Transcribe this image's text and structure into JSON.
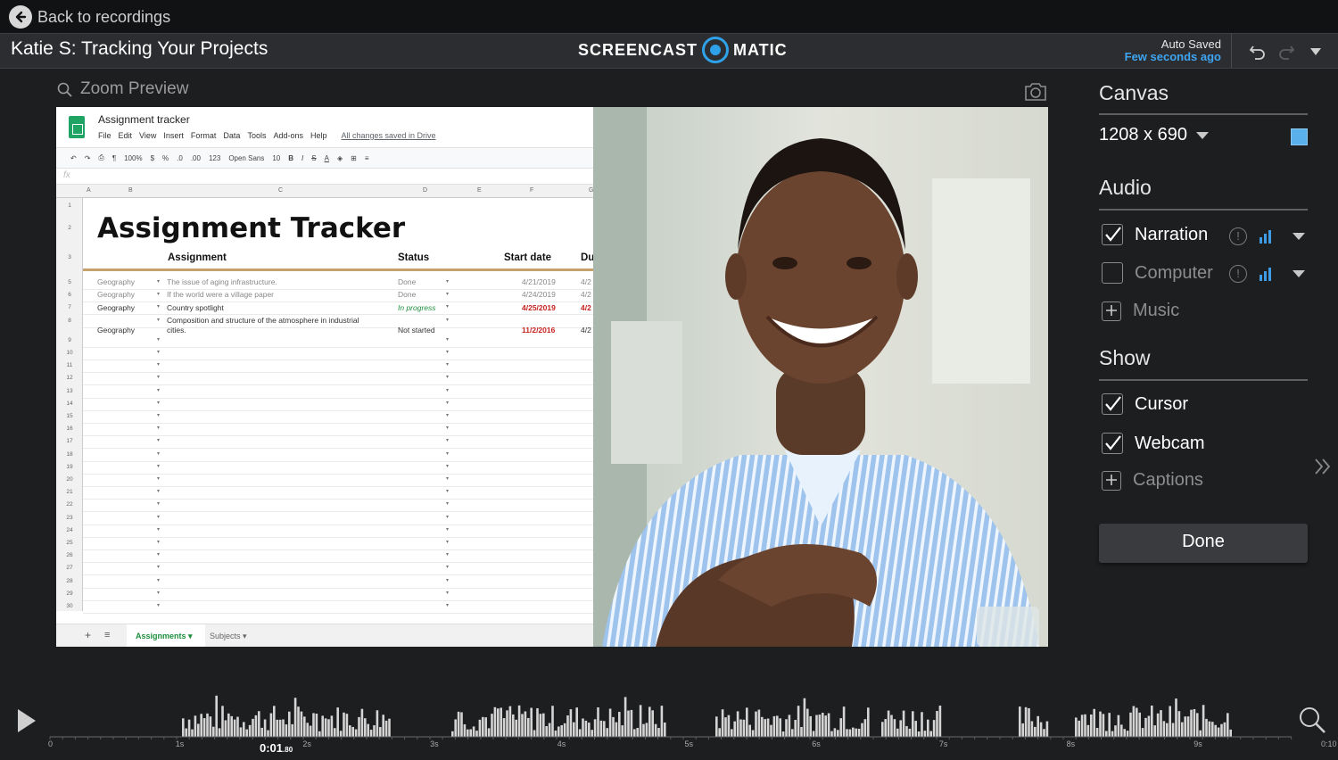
{
  "topbar": {
    "back_label": "Back to recordings"
  },
  "titlebar": {
    "recording_title": "Katie S: Tracking Your Projects",
    "brand_left": "SCREENCAST",
    "brand_right": "MATIC",
    "autosave_label": "Auto Saved",
    "autosave_time": "Few seconds ago"
  },
  "preview": {
    "zoom_label": "Zoom Preview",
    "sheet": {
      "doc_title": "Assignment tracker",
      "menu": [
        "File",
        "Edit",
        "View",
        "Insert",
        "Format",
        "Data",
        "Tools",
        "Add-ons",
        "Help"
      ],
      "saved_note": "All changes saved in Drive",
      "toolbar": {
        "zoom": "100%",
        "currency": "$",
        "percent": "%",
        "dec1": ".0",
        "dec2": ".00",
        "format": "123",
        "font": "Open Sans",
        "size": "10",
        "bold": "B",
        "italic": "I",
        "strike": "S",
        "color": "A"
      },
      "fx": "fx",
      "columns": [
        "A",
        "B",
        "C",
        "D",
        "E",
        "F",
        "G"
      ],
      "title": "Assignment Tracker",
      "headers": {
        "assignment": "Assignment",
        "status": "Status",
        "start": "Start date",
        "due": "Du"
      },
      "rows": [
        {
          "subject": "Geography",
          "assignment": "The issue of aging infrastructure.",
          "status": "Done",
          "start": "4/21/2019",
          "due": "4/2"
        },
        {
          "subject": "Geography",
          "assignment": "If the world were a village paper",
          "status": "Done",
          "start": "4/24/2019",
          "due": "4/2"
        },
        {
          "subject": "Geography",
          "assignment": "Country spotlight",
          "status": "In progress",
          "start": "4/25/2019",
          "due": "4/2"
        },
        {
          "subject": "Geography",
          "assignment_line1": "Composition and structure of the atmosphere in industrial",
          "assignment_line2": "cities.",
          "status": "Not started",
          "start": "11/2/2016",
          "due": "4/2"
        }
      ],
      "row_numbers": [
        "1",
        "2",
        "3",
        "5",
        "6",
        "7",
        "8",
        "9",
        "10",
        "11",
        "12",
        "13",
        "14",
        "15",
        "16",
        "17",
        "18",
        "19",
        "20",
        "21",
        "22",
        "23",
        "24",
        "25",
        "26",
        "27",
        "28",
        "29",
        "30"
      ],
      "tabs": {
        "add": "+",
        "list": "≡",
        "active": "Assignments ▾",
        "other": "Subjects ▾"
      }
    }
  },
  "sidebar": {
    "canvas_heading": "Canvas",
    "canvas_size": "1208 x 690",
    "canvas_color": "#5ab0ea",
    "audio_heading": "Audio",
    "audio": [
      {
        "label": "Narration",
        "checked": true
      },
      {
        "label": "Computer",
        "checked": false
      },
      {
        "label": "Music",
        "add": true
      }
    ],
    "show_heading": "Show",
    "show": [
      {
        "label": "Cursor",
        "checked": true
      },
      {
        "label": "Webcam",
        "checked": true
      },
      {
        "label": "Captions",
        "add": true
      }
    ],
    "done_label": "Done"
  },
  "timeline": {
    "ticks": [
      "0",
      "1s",
      "2s",
      "3s",
      "4s",
      "5s",
      "6s",
      "7s",
      "8s",
      "9s",
      "0:10"
    ],
    "playhead_main": "0:01",
    "playhead_frac": ".80"
  },
  "colors": {
    "accent": "#2ea1e8",
    "background": "#1d1e20",
    "waveform": "#d4d4d4"
  }
}
